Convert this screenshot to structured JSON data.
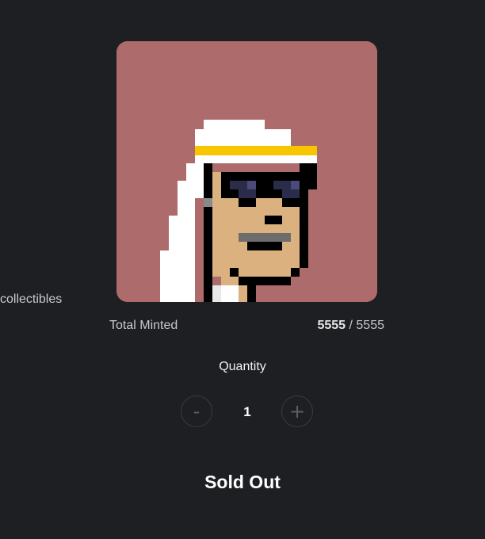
{
  "side": {
    "text": "collectibles"
  },
  "art": {
    "background_color": "#ad6b6b",
    "subject": "pixel-art-avatar"
  },
  "mint": {
    "label": "Total Minted",
    "minted": "5555",
    "separator": " / ",
    "total": "5555"
  },
  "quantity": {
    "label": "Quantity",
    "value": "1",
    "minus_label": "-",
    "plus_label": "+"
  },
  "status": {
    "label": "Sold Out"
  }
}
